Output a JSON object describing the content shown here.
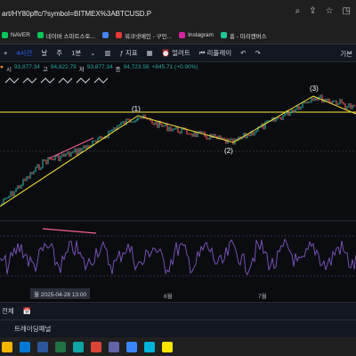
{
  "browser": {
    "url": "art/HY80pffc/?symbol=BITMEX%3ABTCUSD.P",
    "bookmarks": [
      {
        "label": "NAVER",
        "color": "#03c75a"
      },
      {
        "label": "네이버 스마트스토...",
        "color": "#03c75a"
      },
      {
        "label": "",
        "color": "#4285f4"
      },
      {
        "label": "워크넷메인 - 구인...",
        "color": "#e53935"
      },
      {
        "label": "Instagram",
        "color": "#d6249f"
      },
      {
        "label": "홈 - 미리캔버스",
        "color": "#20c997"
      }
    ]
  },
  "toolbar": {
    "items": [
      "4시간",
      "날",
      "주",
      "1분",
      "⌄",
      "",
      "지표",
      "⌄",
      "",
      "얼러트",
      "리플레이",
      "↶",
      "↷"
    ],
    "right_label": "기본"
  },
  "legend": {
    "open_label": "시",
    "open": "93,877.34",
    "high_label": "고",
    "high": "94,822.79",
    "low_label": "저",
    "low": "93,877.34",
    "close_label": "종",
    "close": "94,723.56",
    "change": "+845.71 (+0.90%)"
  },
  "waves": [
    "(1)",
    "(2)",
    "(3)"
  ],
  "time_axis": {
    "labels": [
      "6월",
      "7월"
    ],
    "date_badge": "월 2025-04-28  13:00"
  },
  "range_bar": {
    "label": "전체"
  },
  "panel": {
    "label": "트레이딩패널"
  },
  "colors": {
    "up": "#26a69a",
    "down": "#ef5350",
    "wave": "#ffeb3b",
    "rsi": "#7e57c2",
    "annot": "#f06292"
  }
}
